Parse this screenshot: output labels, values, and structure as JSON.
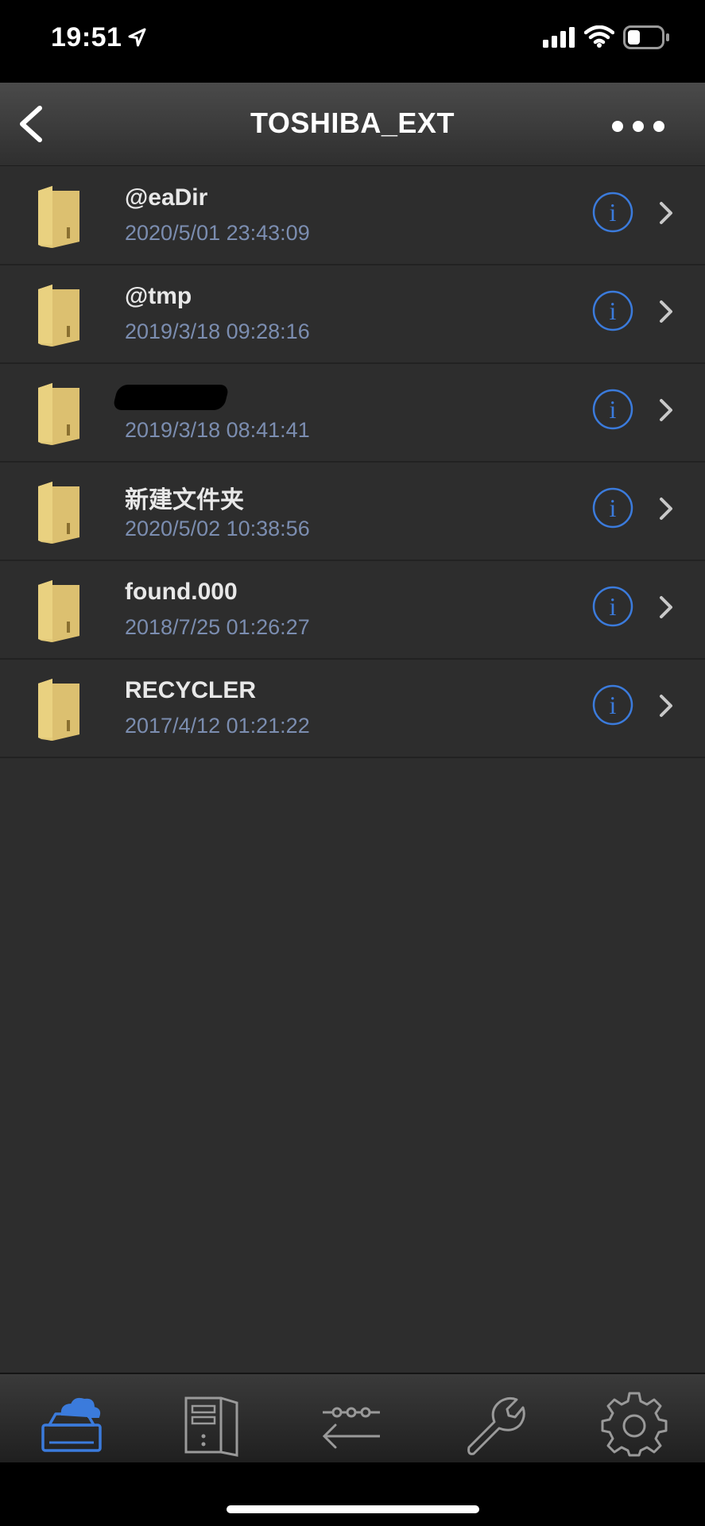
{
  "status_bar": {
    "time": "19:51",
    "icons": [
      "location-arrow-icon",
      "signal-icon",
      "wifi-icon",
      "battery-icon"
    ]
  },
  "nav": {
    "title": "TOSHIBA_EXT",
    "back_icon": "chevron-left-icon",
    "more_icon": "more-horizontal-icon"
  },
  "files": [
    {
      "name": "@eaDir",
      "date": "2020/5/01 23:43:09",
      "redacted": false
    },
    {
      "name": "@tmp",
      "date": "2019/3/18 09:28:16",
      "redacted": false
    },
    {
      "name": "",
      "date": "2019/3/18 08:41:41",
      "redacted": true
    },
    {
      "name": "新建文件夹",
      "date": "2020/5/02 10:38:56",
      "redacted": false
    },
    {
      "name": "found.000",
      "date": "2018/7/25 01:26:27",
      "redacted": false
    },
    {
      "name": "RECYCLER",
      "date": "2017/4/12 01:21:22",
      "redacted": false
    }
  ],
  "tabs": [
    {
      "icon": "cloud-drive-icon",
      "active": true
    },
    {
      "icon": "server-icon",
      "active": false
    },
    {
      "icon": "transfer-icon",
      "active": false
    },
    {
      "icon": "wrench-icon",
      "active": false
    },
    {
      "icon": "gear-icon",
      "active": false
    }
  ],
  "colors": {
    "accent": "#3b7bdc",
    "date_text": "#7b8db0",
    "folder": "#e8cf7e",
    "background": "#2d2d2d"
  }
}
